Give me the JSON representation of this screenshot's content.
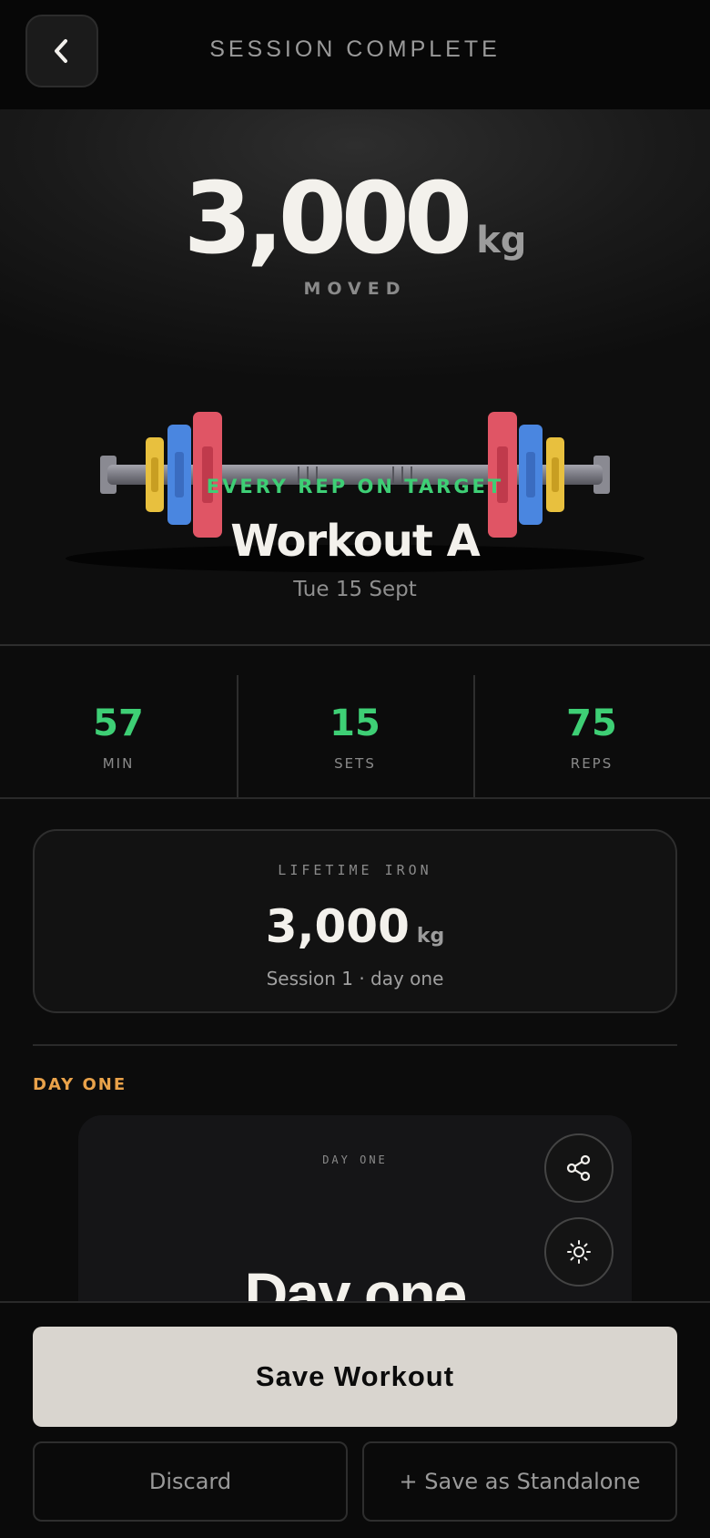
{
  "header": {
    "title": "SESSION COMPLETE",
    "back_icon": "chevron-left-icon"
  },
  "hero": {
    "total_value": "3,000",
    "total_unit": "kg",
    "total_label": "MOVED",
    "tagline": "EVERY REP ON TARGET",
    "workout_name": "Workout A",
    "date": "Tue 15 Sept",
    "plate_colors": [
      "#e05565",
      "#4a86e0",
      "#e8c03e"
    ],
    "tagline_color": "#3ecf75"
  },
  "stats": [
    {
      "value": "57",
      "label": "MIN"
    },
    {
      "value": "15",
      "label": "SETS"
    },
    {
      "value": "75",
      "label": "REPS"
    }
  ],
  "lifetime": {
    "label": "LIFETIME IRON",
    "value": "3,000",
    "unit": "kg",
    "subtitle": "Session 1 · day one"
  },
  "section": {
    "label": "DAY ONE"
  },
  "day_card": {
    "label": "DAY ONE",
    "title": "Day one",
    "share_icon": "share-icon",
    "theme_icon": "sun-icon"
  },
  "actions": {
    "save": "Save Workout",
    "discard": "Discard",
    "standalone": "+ Save as Standalone"
  }
}
